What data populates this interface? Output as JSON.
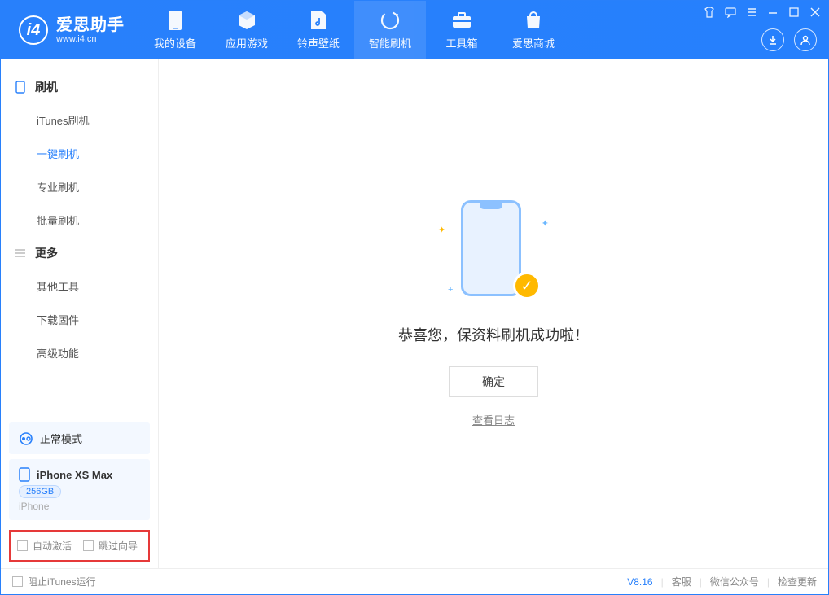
{
  "app": {
    "title": "爱思助手",
    "subtitle": "www.i4.cn"
  },
  "nav": {
    "items": [
      {
        "label": "我的设备"
      },
      {
        "label": "应用游戏"
      },
      {
        "label": "铃声壁纸"
      },
      {
        "label": "智能刷机"
      },
      {
        "label": "工具箱"
      },
      {
        "label": "爱思商城"
      }
    ]
  },
  "sidebar": {
    "section1": {
      "title": "刷机",
      "items": [
        "iTunes刷机",
        "一键刷机",
        "专业刷机",
        "批量刷机"
      ]
    },
    "section2": {
      "title": "更多",
      "items": [
        "其他工具",
        "下载固件",
        "高级功能"
      ]
    },
    "mode": "正常模式",
    "device": {
      "name": "iPhone XS Max",
      "storage": "256GB",
      "type": "iPhone"
    },
    "options": {
      "opt1": "自动激活",
      "opt2": "跳过向导"
    }
  },
  "main": {
    "success_title": "恭喜您，保资料刷机成功啦！",
    "ok_label": "确定",
    "log_link": "查看日志"
  },
  "footer": {
    "itunes_block": "阻止iTunes运行",
    "version": "V8.16",
    "links": [
      "客服",
      "微信公众号",
      "检查更新"
    ]
  }
}
